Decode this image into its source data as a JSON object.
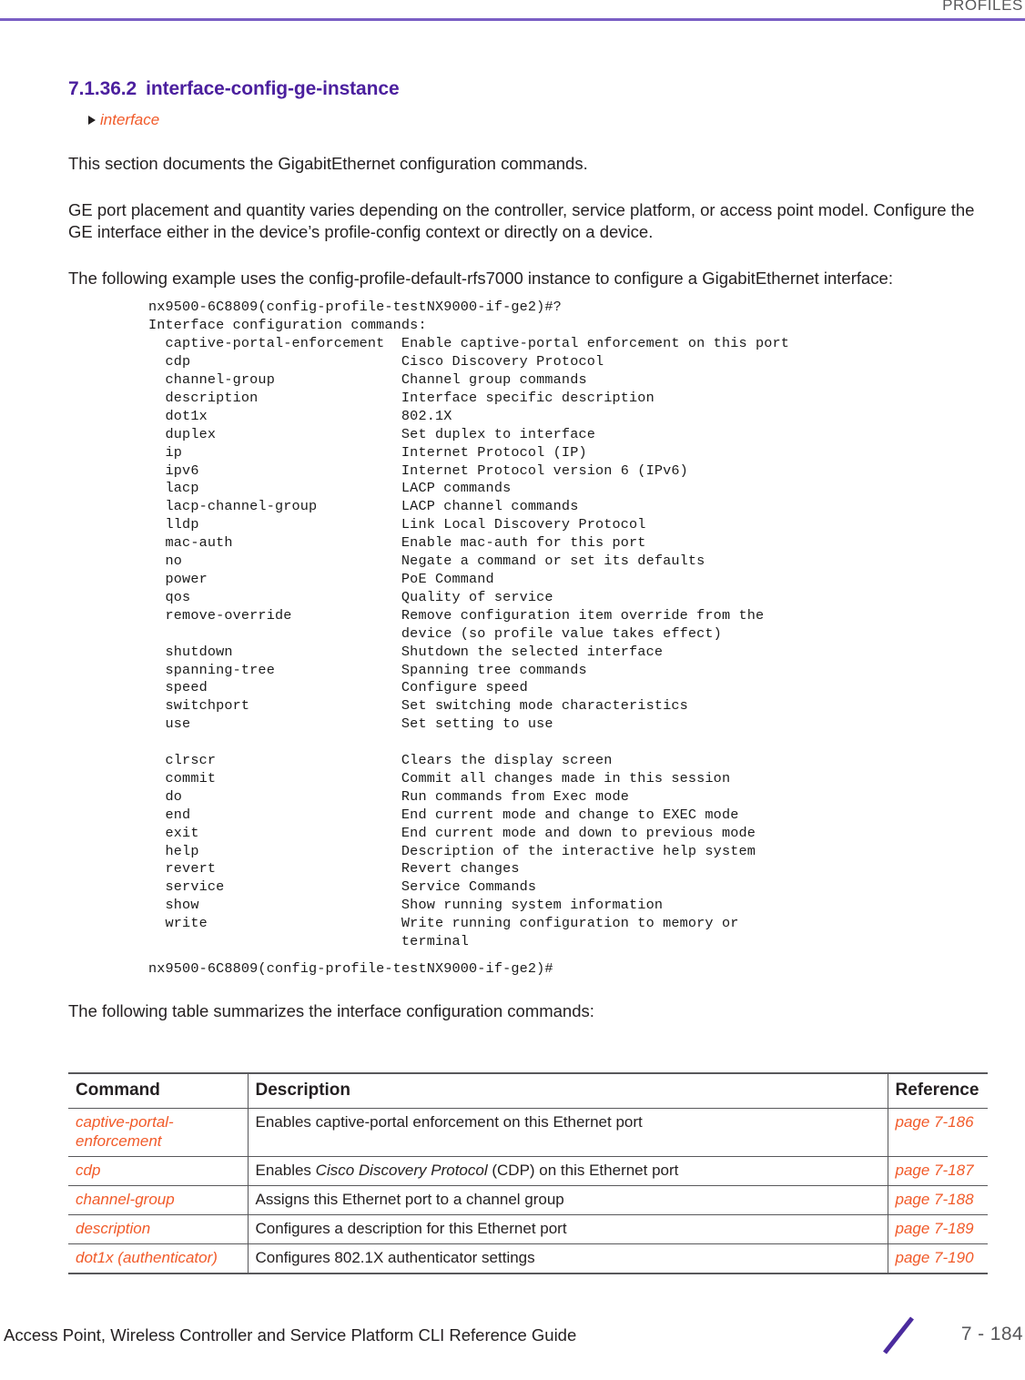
{
  "header": {
    "running_head": "PROFILES",
    "rule_color": "#7a5fc4"
  },
  "heading": {
    "number": "7.1.36.2",
    "title": "interface-config-ge-instance",
    "color": "#4b1f9e"
  },
  "breadcrumb": {
    "label": "interface",
    "color": "#f15a29"
  },
  "paragraphs": {
    "intro": "This section documents the GigabitEthernet configuration commands.",
    "placement": "GE port placement and quantity varies depending on the controller, service platform, or access point model. Configure the GE interface either in the device’s profile-config context or directly on a device.",
    "example_lead": "The following example uses the config-profile-default-rfs7000 instance to configure a GigabitEthernet interface:",
    "table_lead": "The following table summarizes the interface configuration commands:"
  },
  "cli": {
    "block1": "nx9500-6C8809(config-profile-testNX9000-if-ge2)#?\nInterface configuration commands:\n  captive-portal-enforcement  Enable captive-portal enforcement on this port\n  cdp                         Cisco Discovery Protocol\n  channel-group               Channel group commands\n  description                 Interface specific description\n  dot1x                       802.1X\n  duplex                      Set duplex to interface\n  ip                          Internet Protocol (IP)\n  ipv6                        Internet Protocol version 6 (IPv6)\n  lacp                        LACP commands\n  lacp-channel-group          LACP channel commands\n  lldp                        Link Local Discovery Protocol\n  mac-auth                    Enable mac-auth for this port\n  no                          Negate a command or set its defaults\n  power                       PoE Command\n  qos                         Quality of service\n  remove-override             Remove configuration item override from the\n                              device (so profile value takes effect)\n  shutdown                    Shutdown the selected interface\n  spanning-tree               Spanning tree commands\n  speed                       Configure speed\n  switchport                  Set switching mode characteristics\n  use                         Set setting to use\n\n  clrscr                      Clears the display screen\n  commit                      Commit all changes made in this session\n  do                          Run commands from Exec mode\n  end                         End current mode and change to EXEC mode\n  exit                        End current mode and down to previous mode\n  help                        Description of the interactive help system\n  revert                      Revert changes\n  service                     Service Commands\n  show                        Show running system information\n  write                       Write running configuration to memory or\n                              terminal",
    "block2": "nx9500-6C8809(config-profile-testNX9000-if-ge2)#"
  },
  "table": {
    "headers": [
      "Command",
      "Description",
      "Reference"
    ],
    "rows": [
      {
        "command": "captive-portal-enforcement",
        "description_pre": "Enables captive-portal enforcement on this Ethernet port",
        "description_em": "",
        "description_post": "",
        "reference": "page 7-186"
      },
      {
        "command": "cdp",
        "description_pre": "Enables ",
        "description_em": "Cisco Discovery Protocol",
        "description_post": " (CDP) on this Ethernet port",
        "reference": "page 7-187"
      },
      {
        "command": "channel-group",
        "description_pre": "Assigns this Ethernet port to a channel group",
        "description_em": "",
        "description_post": "",
        "reference": "page 7-188"
      },
      {
        "command": "description",
        "description_pre": "Configures a description for this Ethernet port",
        "description_em": "",
        "description_post": "",
        "reference": "page 7-189"
      },
      {
        "command": "dot1x (authenticator)",
        "description_pre": "Configures 802.1X authenticator settings",
        "description_em": "",
        "description_post": "",
        "reference": "page 7-190"
      }
    ]
  },
  "footer": {
    "guide_title": "Access Point, Wireless Controller and Service Platform CLI Reference Guide",
    "page_number": "7 - 184",
    "slash_color": "#4b2b9e"
  }
}
